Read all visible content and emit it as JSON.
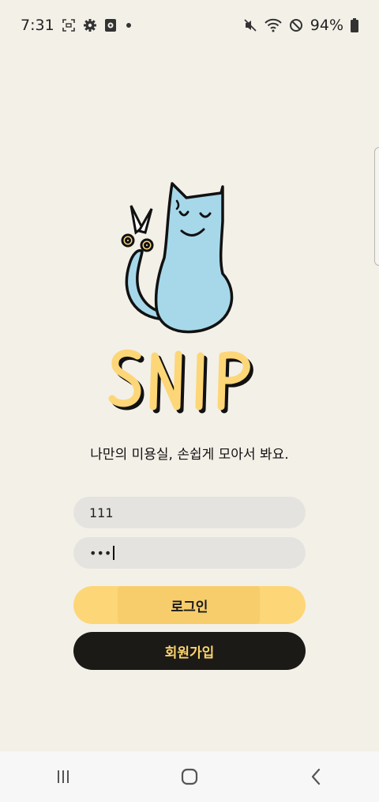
{
  "status_bar": {
    "time": "7:31",
    "battery": "94%",
    "left_icons": [
      "screenshot-icon",
      "gear-icon",
      "record-icon",
      "dot-icon"
    ],
    "right_icons": [
      "mute-icon",
      "wifi-icon",
      "do-not-disturb-icon",
      "battery-icon"
    ]
  },
  "branding": {
    "logo": "SNIP",
    "logo_icon": "cat-with-scissors-icon",
    "tagline": "나만의 미용실, 손쉽게 모아서 봐요."
  },
  "form": {
    "id_value": "111",
    "password_mask": "•••",
    "login_label": "로그인",
    "signup_label": "회원가입"
  },
  "nav_bar": {
    "icons": [
      "recent-apps-icon",
      "home-icon",
      "back-icon"
    ]
  },
  "colors": {
    "background": "#f3f0e8",
    "accent_yellow": "#fdd677",
    "cat_blue": "#a6d8ea",
    "dark_button": "#1c1a16"
  }
}
